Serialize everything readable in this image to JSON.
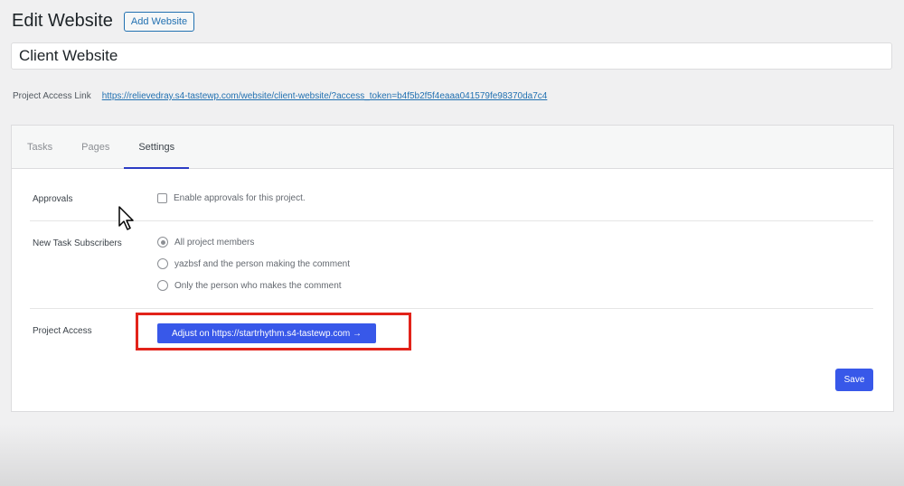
{
  "header": {
    "title": "Edit Website",
    "add_button": "Add Website"
  },
  "title_input": {
    "value": "Client Website"
  },
  "access": {
    "label": "Project Access Link",
    "link": "https://relievedray.s4-tastewp.com/website/client-website/?access_token=b4f5b2f5f4eaaa041579fe98370da7c4"
  },
  "tabs": [
    {
      "label": "Tasks",
      "active": false
    },
    {
      "label": "Pages",
      "active": false
    },
    {
      "label": "Settings",
      "active": true
    }
  ],
  "settings": {
    "approvals": {
      "label": "Approvals",
      "checkbox_label": "Enable approvals for this project.",
      "checked": false
    },
    "subscribers": {
      "label": "New Task Subscribers",
      "options": [
        {
          "label": "All project members",
          "selected": true
        },
        {
          "label": "yazbsf and the person making the comment",
          "selected": false
        },
        {
          "label": "Only the person who makes the comment",
          "selected": false
        }
      ]
    },
    "project_access": {
      "label": "Project Access",
      "button": "Adjust on https://startrhythm.s4-tastewp.com →"
    },
    "save_label": "Save"
  },
  "colors": {
    "accent": "#3858e9",
    "highlight": "#e2231a",
    "link": "#2271b1"
  }
}
